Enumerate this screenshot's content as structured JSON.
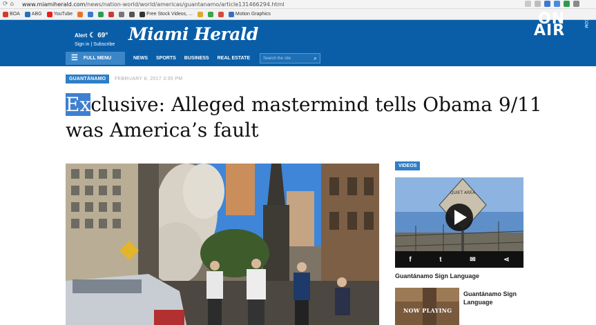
{
  "browser": {
    "url_host": "www.miamiherald.com",
    "url_path": "/news/nation-world/world/americas/guantanamo/article131466294.html",
    "nav_glyphs": "⟳  ⌂"
  },
  "bookmarks": [
    {
      "label": "BOA",
      "color": "#d23b2c"
    },
    {
      "label": "ABG",
      "color": "#2b6fb8"
    },
    {
      "label": "YouTube",
      "color": "#e62117"
    },
    {
      "label": "",
      "color": "#e8742a"
    },
    {
      "label": "",
      "color": "#3b7ad0"
    },
    {
      "label": "",
      "color": "#2d9b4f"
    },
    {
      "label": "",
      "color": "#cc3b33"
    },
    {
      "label": "",
      "color": "#777777"
    },
    {
      "label": "",
      "color": "#555555"
    },
    {
      "label": "Free Stock Videos, ...",
      "color": "#333333"
    },
    {
      "label": "",
      "color": "#e0a82c"
    },
    {
      "label": "",
      "color": "#39a845"
    },
    {
      "label": "",
      "color": "#d64b3a"
    },
    {
      "label": "Motion Graphics",
      "color": "#3a6fc0"
    }
  ],
  "header": {
    "alert_label": "Alert",
    "weather_temp": "69°",
    "signin_text": "Sign in | Subscribe",
    "logo_text": "Miami Herald",
    "onair_line1": "ON",
    "onair_line2": "AIR",
    "onair_small": ".COM"
  },
  "nav": {
    "full_menu_label": "FULL MENU",
    "links": [
      "NEWS",
      "SPORTS",
      "BUSINESS",
      "REAL ESTATE"
    ],
    "search_placeholder": "Search the site"
  },
  "article": {
    "section": "GUANTÁNAMO",
    "date": "FEBRUARY 8, 2017 3:35 PM",
    "headline_selected": "Ex",
    "headline_line1_rest": "clusive: Alleged mastermind tells Obama 9/11",
    "headline_line2": "was America’s fault"
  },
  "sidebar": {
    "videos_label": "VIDEOS",
    "video1_title": "Guantánamo Sign Language",
    "video2_title": "Guantánamo Sign Language",
    "now_playing": "NOW PLAYING",
    "share_icons": [
      "f",
      "t",
      "✉",
      "⋖"
    ],
    "sign_text": "QUIET AREA"
  },
  "colors": {
    "brand_blue": "#0a5ea8",
    "badge_blue": "#2f7ec6",
    "selection_blue": "#3f7fd0"
  }
}
